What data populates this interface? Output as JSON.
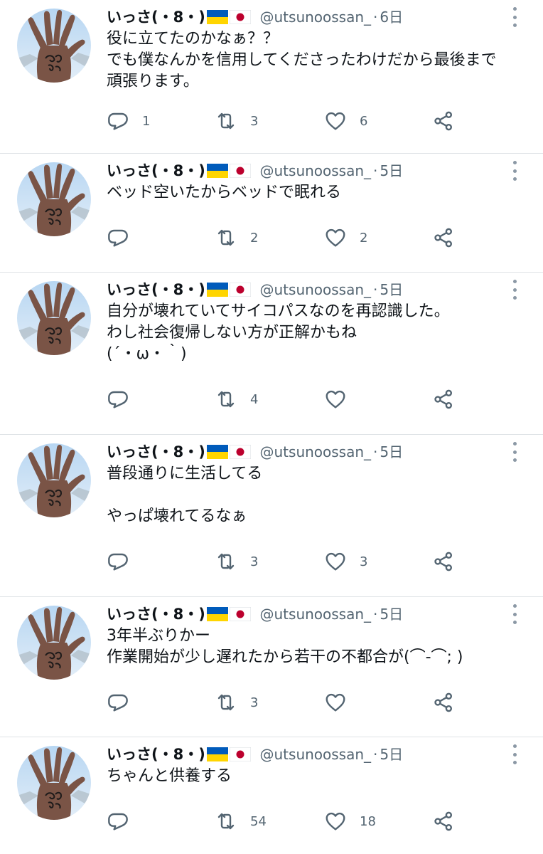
{
  "colors": {
    "text": "#0f1419",
    "secondary": "#536471",
    "icon": "#536471",
    "divider": "#dfe3e6",
    "flag_ua_blue": "#005bbb",
    "flag_ua_yellow": "#ffd500",
    "flag_jp_red": "#bc002d"
  },
  "icons": {
    "reply": "reply-icon",
    "retweet": "retweet-icon",
    "like": "heart-icon",
    "share": "share-icon",
    "more": "more-vertical-icon",
    "flags": [
      "ukraine-flag-icon",
      "japan-flag-icon"
    ]
  },
  "tweets": [
    {
      "display_name": "いっさ(・8・)",
      "handle": "@utsunoossan_",
      "separator": "·",
      "time": "6日",
      "lines": [
        "役に立てたのかなぁ？？",
        "でも僕なんかを信用してくださったわけだから最後まで",
        "頑張ります。"
      ],
      "reply_count": "1",
      "retweet_count": "3",
      "like_count": "6"
    },
    {
      "display_name": "いっさ(・8・)",
      "handle": "@utsunoossan_",
      "separator": "·",
      "time": "5日",
      "lines": [
        "ベッド空いたからベッドで眠れる"
      ],
      "reply_count": "",
      "retweet_count": "2",
      "like_count": "2"
    },
    {
      "display_name": "いっさ(・8・)",
      "handle": "@utsunoossan_",
      "separator": "·",
      "time": "5日",
      "lines": [
        "自分が壊れていてサイコパスなのを再認識した。",
        "わし社会復帰しない方が正解かもね",
        "(´・ω・｀)"
      ],
      "reply_count": "",
      "retweet_count": "4",
      "like_count": ""
    },
    {
      "display_name": "いっさ(・8・)",
      "handle": "@utsunoossan_",
      "separator": "·",
      "time": "5日",
      "lines": [
        "普段通りに生活してる",
        "",
        "やっぱ壊れてるなぁ"
      ],
      "reply_count": "",
      "retweet_count": "3",
      "like_count": "3"
    },
    {
      "display_name": "いっさ(・8・)",
      "handle": "@utsunoossan_",
      "separator": "·",
      "time": "5日",
      "lines": [
        "3年半ぶりかー",
        "作業開始が少し遅れたから若干の不都合が(⌒-⌒; )"
      ],
      "reply_count": "",
      "retweet_count": "3",
      "like_count": ""
    },
    {
      "display_name": "いっさ(・8・)",
      "handle": "@utsunoossan_",
      "separator": "·",
      "time": "5日",
      "lines": [
        "ちゃんと供養する"
      ],
      "reply_count": "",
      "retweet_count": "54",
      "like_count": "18"
    }
  ]
}
